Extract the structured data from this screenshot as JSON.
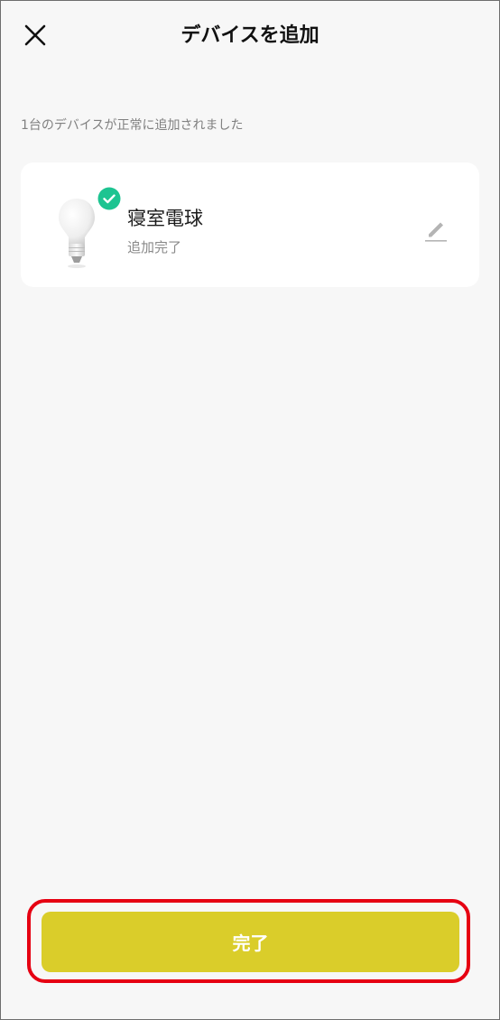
{
  "header": {
    "title": "デバイスを追加",
    "close_icon": "close-icon"
  },
  "summary": "1台のデバイスが正常に追加されました",
  "device": {
    "name": "寝室電球",
    "status": "追加完了",
    "image_icon": "light-bulb-icon",
    "badge_icon": "check-circle-icon",
    "edit_icon": "pencil-icon"
  },
  "footer": {
    "done_label": "完了"
  },
  "colors": {
    "accent": "#dacd2a",
    "success": "#1dc491",
    "highlight": "#e60012",
    "background": "#f7f7f7"
  }
}
